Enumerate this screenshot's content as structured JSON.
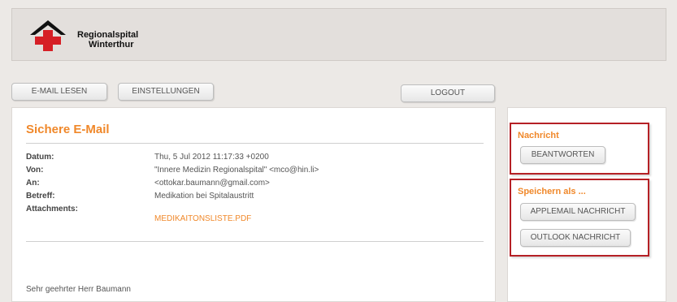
{
  "header": {
    "logo_line1": "Regionalspital",
    "logo_line2": "Winterthur",
    "logo_colors": {
      "roof": "#111111",
      "cross": "#d61f26"
    }
  },
  "nav": {
    "read_mail": "E-MAIL LESEN",
    "settings": "EINSTELLUNGEN",
    "logout": "LOGOUT"
  },
  "message": {
    "title": "Sichere E-Mail",
    "fields": [
      {
        "label": "Datum:",
        "value": "Thu, 5 Jul 2012 11:17:33 +0200"
      },
      {
        "label": "Von:",
        "value": "\"Innere Medizin Regionalspital\" <mco@hin.li>"
      },
      {
        "label": "An:",
        "value": "<ottokar.baumann@gmail.com>"
      },
      {
        "label": "Betreff:",
        "value": "Medikation bei Spitalaustritt"
      },
      {
        "label": "Attachments:",
        "value": ""
      }
    ],
    "attachment": "MEDIKAITONSLISTE.PDF",
    "body_start": "Sehr geehrter Herr Baumann"
  },
  "sidebar": {
    "message_heading": "Nachricht",
    "reply_button": "BEANTWORTEN",
    "save_heading": "Speichern als ...",
    "applemail_button": "APPLEMAIL NACHRICHT",
    "outlook_button": "OUTLOOK NACHRICHT"
  },
  "colors": {
    "accent": "#f0882a",
    "highlight_border": "#b52025"
  }
}
